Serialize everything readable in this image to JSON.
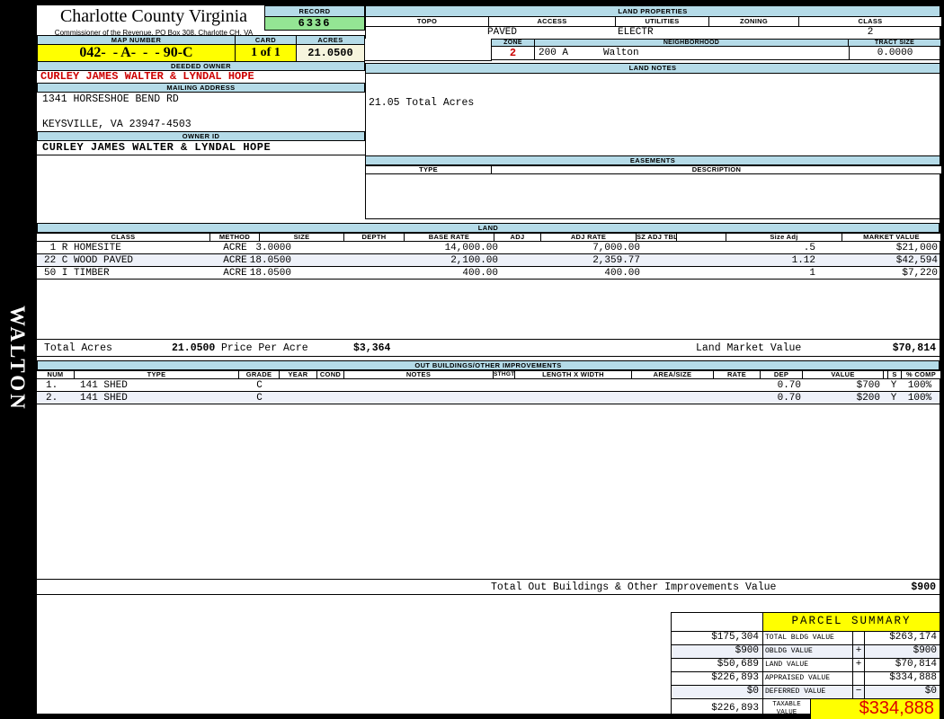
{
  "colors": {
    "band_blue": "#b5dbe8",
    "record_green": "#94e594",
    "highlight_yellow": "#ffff00",
    "acres_cream": "#f6f4dd",
    "alert_red": "#cc0000",
    "taxable_red": "#dd0000"
  },
  "sidebar": {
    "label": "WALTON"
  },
  "header": {
    "county": "Charlotte County Virginia",
    "subtitle": "Commissioner of the Revenue, PO Box 308, Charlotte CH, VA",
    "record_label": "RECORD",
    "record_value": "6336",
    "map_number_label": "MAP NUMBER",
    "map_number": "042-  - A-  -  - 90-C",
    "card_label": "CARD",
    "card_value": "1 of 1",
    "acres_label": "ACRES",
    "acres_value": "21.0500"
  },
  "owner": {
    "deeded_owner_label": "DEEDED OWNER",
    "deeded_owner": "CURLEY JAMES WALTER & LYNDAL HOPE",
    "mailing_address_label": "MAILING ADDRESS",
    "address_line1": "1341 HORSESHOE BEND RD",
    "address_line2": "KEYSVILLE, VA 23947-4503",
    "owner_id_label": "OWNER ID",
    "owner_id": "CURLEY JAMES WALTER & LYNDAL HOPE"
  },
  "land_properties": {
    "title": "LAND PROPERTIES",
    "topo_label": "TOPO",
    "access_label": "ACCESS",
    "utilities_label": "UTILITIES",
    "zoning_label": "ZONING",
    "class_label": "CLASS",
    "topo": "",
    "access": "PAVED",
    "utilities": "ELECTR",
    "zoning": "",
    "class": "2",
    "zone_label": "ZONE",
    "neighborhood_label": "NEIGHBORHOOD",
    "tract_size_label": "TRACT SIZE",
    "zone": "2",
    "neighborhood_code": "200 A",
    "neighborhood_name": "Walton",
    "tract_size": "0.0000"
  },
  "land_notes": {
    "title": "LAND NOTES",
    "note": "21.05 Total Acres"
  },
  "easements": {
    "title": "EASEMENTS",
    "type_label": "TYPE",
    "description_label": "DESCRIPTION"
  },
  "land": {
    "title": "LAND",
    "headers": [
      "CLASS",
      "METHOD",
      "SIZE",
      "DEPTH",
      "BASE RATE",
      "ADJ",
      "ADJ RATE",
      "SZ ADJ TBL",
      "",
      "Size Adj",
      "MARKET VALUE"
    ],
    "rows": [
      {
        "class_code": " 1 R HOMESITE",
        "method": "ACRE",
        "size": "3.0000",
        "depth": "",
        "base_rate": "14,000.00",
        "adj": "",
        "adj_rate": "7,000.00",
        "sz_adj_tbl": "",
        "size_adj": ".5",
        "market_value": "$21,000"
      },
      {
        "class_code": "22 C WOOD PAVED",
        "method": "ACRE",
        "size": "18.0500",
        "depth": "",
        "base_rate": "2,100.00",
        "adj": "",
        "adj_rate": "2,359.77",
        "sz_adj_tbl": "",
        "size_adj": "1.12",
        "market_value": "$42,594"
      },
      {
        "class_code": "50 I TIMBER",
        "method": "ACRE",
        "size": "18.0500",
        "depth": "",
        "base_rate": "400.00",
        "adj": "",
        "adj_rate": "400.00",
        "sz_adj_tbl": "",
        "size_adj": "1",
        "market_value": "$7,220"
      }
    ],
    "total_acres_label": "Total Acres",
    "total_acres": "21.0500",
    "price_per_acre_label": "Price Per Acre",
    "price_per_acre": "$3,364",
    "market_value_label": "Land Market Value",
    "market_value": "$70,814"
  },
  "out_buildings": {
    "title": "OUT BUILDINGS/OTHER IMPROVEMENTS",
    "headers": [
      "NUM",
      "TYPE",
      "GRADE",
      "YEAR",
      "COND",
      "NOTES",
      "STHGT",
      "LENGTH X WIDTH",
      "AREA/SIZE",
      "RATE",
      "DEP",
      "VALUE",
      "",
      "S",
      "% COMP"
    ],
    "rows": [
      {
        "num": "1.",
        "type": "141 SHED",
        "grade": "C",
        "dep": "0.70",
        "value": "$700",
        "s": "Y",
        "pct_comp": "100%"
      },
      {
        "num": "2.",
        "type": "141 SHED",
        "grade": "C",
        "dep": "0.70",
        "value": "$200",
        "s": "Y",
        "pct_comp": "100%"
      }
    ],
    "total_label": "Total Out Buildings & Other Improvements Value",
    "total_value": "$900"
  },
  "parcel_summary": {
    "title": "PARCEL SUMMARY",
    "rows": [
      {
        "prior": "$175,304",
        "label": "TOTAL BLDG VALUE",
        "op": "",
        "value": "$263,174"
      },
      {
        "prior": "$900",
        "label": "OBLDG VALUE",
        "op": "+",
        "value": "$900"
      },
      {
        "prior": "$50,689",
        "label": "LAND VALUE",
        "op": "+",
        "value": "$70,814"
      },
      {
        "prior": "$226,893",
        "label": "APPRAISED VALUE",
        "op": "",
        "value": "$334,888"
      },
      {
        "prior": "$0",
        "label": "DEFERRED VALUE",
        "op": "−",
        "value": "$0"
      }
    ],
    "taxable_prior": "$226,893",
    "taxable_label": "TAXABLE\nVALUE",
    "taxable_value": "$334,888"
  }
}
